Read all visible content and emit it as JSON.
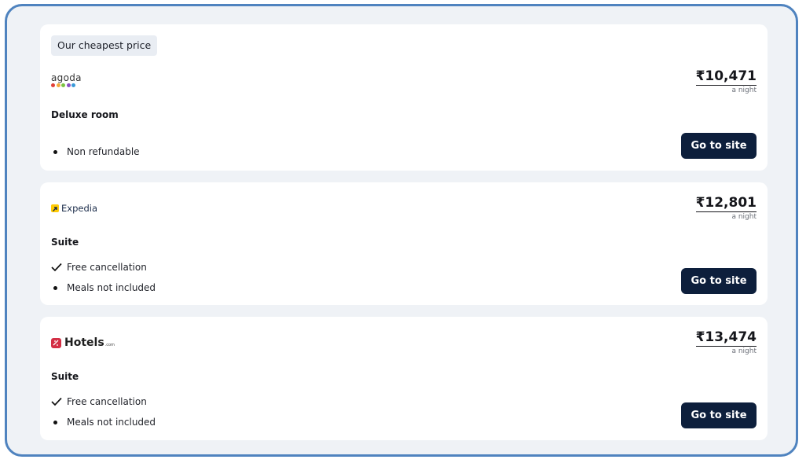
{
  "badge": "Our cheapest price",
  "offers": [
    {
      "provider": "agoda",
      "room": "Deluxe room",
      "price": "₹10,471",
      "per": "a night",
      "features": [
        {
          "icon": "bullet-icon",
          "text": "Non refundable"
        }
      ],
      "button": "Go to site"
    },
    {
      "provider": "Expedia",
      "room": "Suite",
      "price": "₹12,801",
      "per": "a night",
      "features": [
        {
          "icon": "check-icon",
          "text": "Free cancellation"
        },
        {
          "icon": "bullet-icon",
          "text": "Meals not included"
        }
      ],
      "button": "Go to site"
    },
    {
      "provider": "Hotels",
      "provider_suffix": ".com",
      "room": "Suite",
      "price": "₹13,474",
      "per": "a night",
      "features": [
        {
          "icon": "check-icon",
          "text": "Free cancellation"
        },
        {
          "icon": "bullet-icon",
          "text": "Meals not included"
        }
      ],
      "button": "Go to site"
    }
  ],
  "colors": {
    "frame_border": "#4f83bf",
    "background": "#eff2f6",
    "button": "#0d1f3c",
    "agoda_dots": [
      "#e0413a",
      "#f2a93b",
      "#7cc243",
      "#8a4ec4",
      "#3a9ad9"
    ]
  }
}
